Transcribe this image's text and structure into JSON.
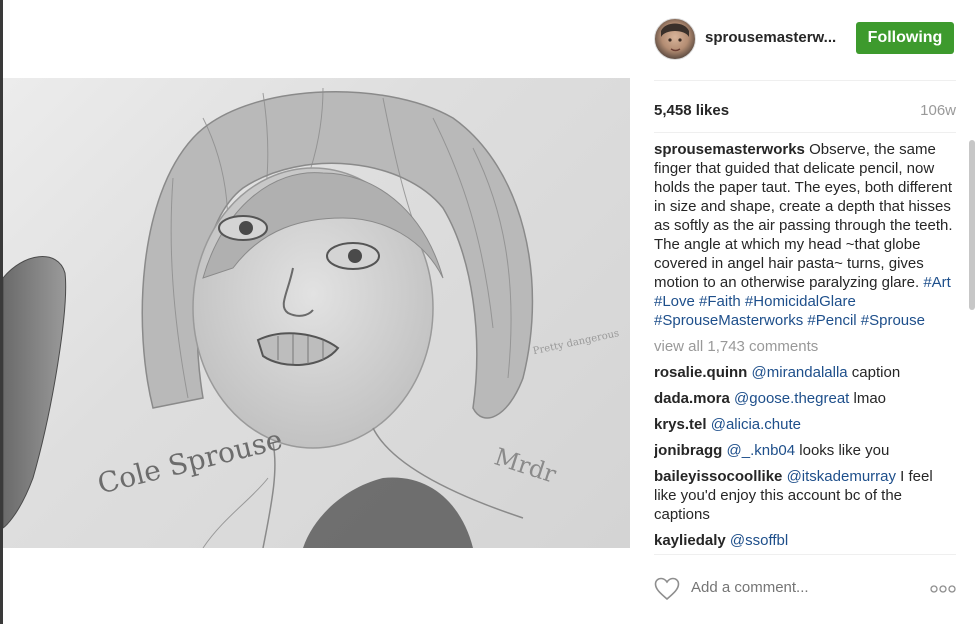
{
  "post": {
    "username": "sprousemasterw...",
    "follow_label": "Following",
    "likes": "5,458 likes",
    "age": "106w",
    "caption": {
      "username": "sprousemasterworks",
      "text": " Observe, the same finger that guided that delicate pencil, now holds the paper taut. The eyes, both different in size and shape, create a depth that hisses as softly as the air passing through the teeth. The angle at which my head ~that globe covered in angel hair pasta~ turns, gives motion to an otherwise paralyzing glare. ",
      "hashtags": [
        "#Art",
        "#Love",
        "#Faith",
        "#HomicidalGlare",
        "#SprouseMasterworks",
        "#Pencil",
        "#Sprouse"
      ]
    },
    "view_all": "view all 1,743 comments",
    "comments": [
      {
        "user": "rosalie.quinn",
        "mention": "@mirandalalla",
        "text": " caption"
      },
      {
        "user": "dada.mora",
        "mention": "@goose.thegreat",
        "text": " lmao"
      },
      {
        "user": "krys.tel",
        "mention": "@alicia.chute",
        "text": ""
      },
      {
        "user": "jonibragg",
        "mention": "@_.knb04",
        "text": " looks like you"
      },
      {
        "user": "baileyissocoollike",
        "mention": "@itskademurray",
        "text": " I feel like you'd enjoy this account bc of the captions"
      },
      {
        "user": "kayliedaly",
        "mention": "@ssoffbl",
        "text": ""
      }
    ],
    "add_comment_placeholder": "Add a comment...",
    "photo": {
      "signature": "Cole Sprouse",
      "scribble_right": "Mrdr",
      "scribble_note": "Pretty dangerous"
    }
  },
  "colors": {
    "follow_button": "#3d9a2d",
    "link": "#1e4f8b",
    "muted": "#999999"
  },
  "icons": {
    "heart": "heart-outline-icon",
    "more": "more-options-icon"
  }
}
